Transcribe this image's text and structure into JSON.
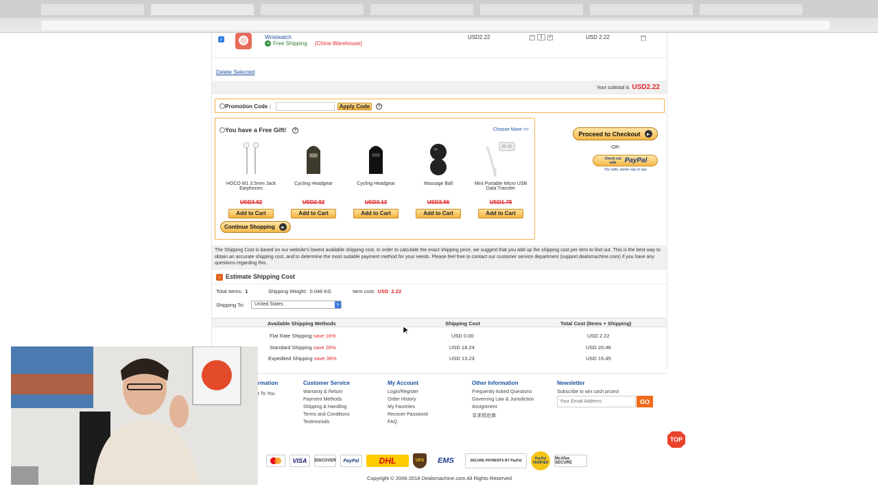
{
  "cart_item": {
    "name": "Wristwatch",
    "shipping_label": "Free Shipping",
    "warehouse": "(China Warehouse)",
    "unit_price": "USD2.22",
    "quantity": "1",
    "line_total": "USD 2.22",
    "qty_minus": "−",
    "qty_plus": "+"
  },
  "delete_selected": "Delete Selected",
  "subtotal": {
    "label": "Your subtotal is",
    "value": "USD2.22"
  },
  "promo": {
    "label": "Promotion Code :",
    "placeholder": "",
    "button": "Apply Code",
    "help": "?"
  },
  "gift": {
    "title": "You have a Free Gift!",
    "help": "?",
    "choose_more": "Choose More >>",
    "items": [
      {
        "name": "HOCO M1 3.5mm Jack Earphones",
        "price": "USD3.02",
        "button": "Add to Cart",
        "icon": "earphones-icon"
      },
      {
        "name": "Cycling Headgear",
        "price": "USD2.92",
        "button": "Add to Cart",
        "icon": "headgear-icon"
      },
      {
        "name": "Cycling Headgear",
        "price": "USD3.13",
        "button": "Add to Cart",
        "icon": "headgear-icon"
      },
      {
        "name": "Massage Ball",
        "price": "USD3.56",
        "button": "Add to Cart",
        "icon": "massage-ball-icon"
      },
      {
        "name": "Mini Portable Micro USB Data Transfer",
        "price": "USD1.78",
        "button": "Add to Cart",
        "icon": "usb-cable-icon"
      }
    ],
    "continue": "Continue Shopping"
  },
  "checkout": {
    "proceed": "Proceed to Checkout",
    "or": "-OR-",
    "paypal_top": "Check out with",
    "paypal_brand": "PayPal",
    "paypal_sub": "The safer, easier way to pay"
  },
  "shipping_note": "The Shipping Cost is based on our website's lowest available shipping cost. In order to calculate the exact shipping price, we suggest that you add up the shipping cost per item to find out. This is the best way to obtain an accurate shipping cost, and to determine the most suitable payment method for your needs. Please feel free to contact our customer service department (support.dealsmachine.com) if you have any questions regarding this.",
  "estimate": {
    "title": "Estimate Shipping Cost",
    "total_items_label": "Total Items:",
    "total_items": "1",
    "weight_label": "Shipping Weight:",
    "weight": "0.046 KG",
    "item_cost_label": "Item cost:",
    "item_cost": "USD  2.22",
    "ship_to_label": "Shipping To:",
    "ship_to": "United States"
  },
  "ship_table": {
    "headers": [
      "Available Shipping Methods",
      "Shipping Cost",
      "Total Cost (Items + Shipping)"
    ],
    "rows": [
      {
        "method": "Flat Rate Shipping",
        "save": "save 16%",
        "cost": "USD 0.00",
        "total": "USD 2.22"
      },
      {
        "method": "Standard Shipping",
        "save": "save 26%",
        "cost": "USD 18.24",
        "total": "USD 20.46"
      },
      {
        "method": "Expedited Shipping",
        "save": "save 36%",
        "cost": "USD 13.23",
        "total": "USD 15.45"
      }
    ]
  },
  "footer": {
    "col1": {
      "title": "rmation",
      "items": [
        "t To You"
      ]
    },
    "col2": {
      "title": "Customer Service",
      "items": [
        "Warranty & Return",
        "Payment Methods",
        "Shipping & Handling",
        "Terms and Conditions",
        "Testimonials"
      ]
    },
    "col3": {
      "title": "My Account",
      "items": [
        "Login/Register",
        "Order History",
        "My Favorites",
        "Recover Password",
        "FAQ"
      ]
    },
    "col4": {
      "title": "Other Information",
      "items": [
        "Frequently Asked Questions",
        "Governing Law & Jurisdiction",
        "Assignment",
        "寻求供应商"
      ]
    },
    "newsletter": {
      "title": "Newsletter",
      "subtitle": "Subscribe to win cash prizes!",
      "placeholder": "Your Email Address",
      "button": "GO"
    }
  },
  "payment_logos": [
    "MasterCard",
    "VISA",
    "DISCOVER",
    "PayPal",
    "DHL",
    "UPS",
    "EMS",
    "SECURE PAYMENTS BY PayPal",
    "PayPal VERIFIED",
    "McAfee SECURE"
  ],
  "copyright": "Copyright © 2006-2018 Dealsmachine.com All Rights Reserved",
  "top_button": "TOP",
  "colors": {
    "accent_red": "#e0252a",
    "link_blue": "#1a4f9c",
    "gold": "#f2b241"
  }
}
